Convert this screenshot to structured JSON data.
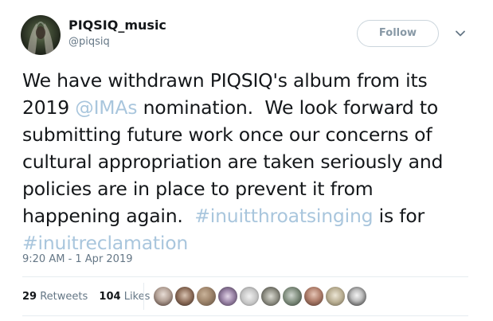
{
  "user": {
    "display_name": "PIQSIQ_music",
    "handle": "@piqsiq",
    "avatar_icon": "avatar-image"
  },
  "follow_label": "Follow",
  "menu_icon": "chevron-down-icon",
  "tweet": {
    "line1": "We have withdrawn PIQSIQ's album from its",
    "line2_pre": "2019 ",
    "line2_mention": "@IMAs",
    "line2_post": " nomination.  We look forward to",
    "line3": "submitting future work once our concerns of",
    "line4": "cultural appropriation are taken seriously and",
    "line5": "policies are in place to prevent it from",
    "line6_pre": "happening again.  ",
    "line6_hashtag": "#inuitthroatsinging",
    "line6_post": " is for",
    "line7_hashtag": "#inuitreclamation"
  },
  "timestamp": "9:20 AM - 1 Apr 2019",
  "stats": {
    "retweets_count": "29",
    "retweets_label": "Retweets",
    "likes_count": "104",
    "likes_label": "Likes"
  },
  "colors": {
    "link": "#a9c6dd",
    "secondary_text": "#657786",
    "divider": "#e6ecf0"
  },
  "likers_count_shown": 10
}
